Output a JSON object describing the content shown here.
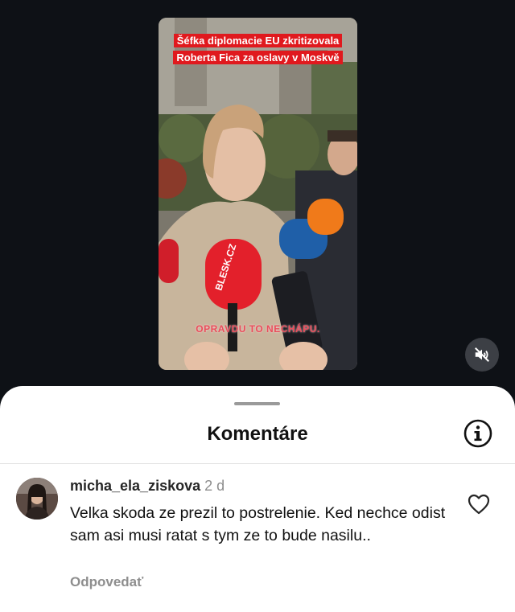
{
  "video": {
    "headline_line1": "Šéfka diplomacie EU zkritizovala",
    "headline_line2": "Roberta Fica za oslavy v Moskvě",
    "caption": "OPRAVDU TO NECHÁPU.",
    "mic_brand": "BLESK.CZ"
  },
  "mute_button": {
    "icon": "speaker-muted-icon"
  },
  "comments_sheet": {
    "title": "Komentáre",
    "info_icon": "info-icon",
    "comments": [
      {
        "username": "micha_ela_ziskova",
        "time": "2 d",
        "text": "Velka skoda ze prezil to postrelenie. Ked nechce odist sam asi musi ratat s tym ze to bude nasilu..",
        "reply_label": "Odpovedať",
        "like_icon": "heart-outline-icon"
      }
    ]
  }
}
